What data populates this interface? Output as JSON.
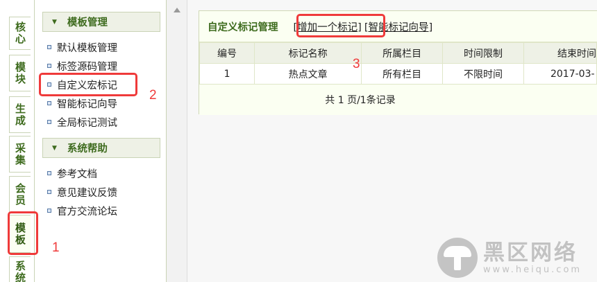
{
  "tabs": [
    {
      "label": "核心"
    },
    {
      "label": "模块"
    },
    {
      "label": "生成"
    },
    {
      "label": "采集"
    },
    {
      "label": "会员"
    },
    {
      "label": "模板"
    },
    {
      "label": "系统"
    }
  ],
  "menu": {
    "sections": [
      {
        "title": "模板管理",
        "items": [
          {
            "label": "默认模板管理"
          },
          {
            "label": "标签源码管理"
          },
          {
            "label": "自定义宏标记"
          },
          {
            "label": "智能标记向导"
          },
          {
            "label": "全局标记测试"
          }
        ]
      },
      {
        "title": "系统帮助",
        "items": [
          {
            "label": "参考文档"
          },
          {
            "label": "意见建议反馈"
          },
          {
            "label": "官方交流论坛"
          }
        ]
      }
    ]
  },
  "panel": {
    "title": "自定义标记管理",
    "add_link": {
      "bracket_open": "[",
      "label": "增加一个标记",
      "bracket_close": "]"
    },
    "wizard_link": {
      "bracket_open": "[",
      "label": "智能标记向导",
      "bracket_close": "]"
    }
  },
  "table": {
    "columns": [
      "编号",
      "标记名称",
      "所属栏目",
      "时间限制",
      "结束时间"
    ],
    "rows": [
      [
        "1",
        "热点文章",
        "所有栏目",
        "不限时间",
        "2017-03-"
      ]
    ],
    "footer": "共 1 页/1条记录"
  },
  "annotations": {
    "color": "#ef3a3a",
    "labels": [
      "1",
      "2",
      "3"
    ]
  },
  "watermark": {
    "text": "黑区网络",
    "url": "www.heiqu.com"
  },
  "colors": {
    "accent_green": "#3e6b1e",
    "header_bg": "#eef1e6",
    "border": "#c9d3b5"
  }
}
